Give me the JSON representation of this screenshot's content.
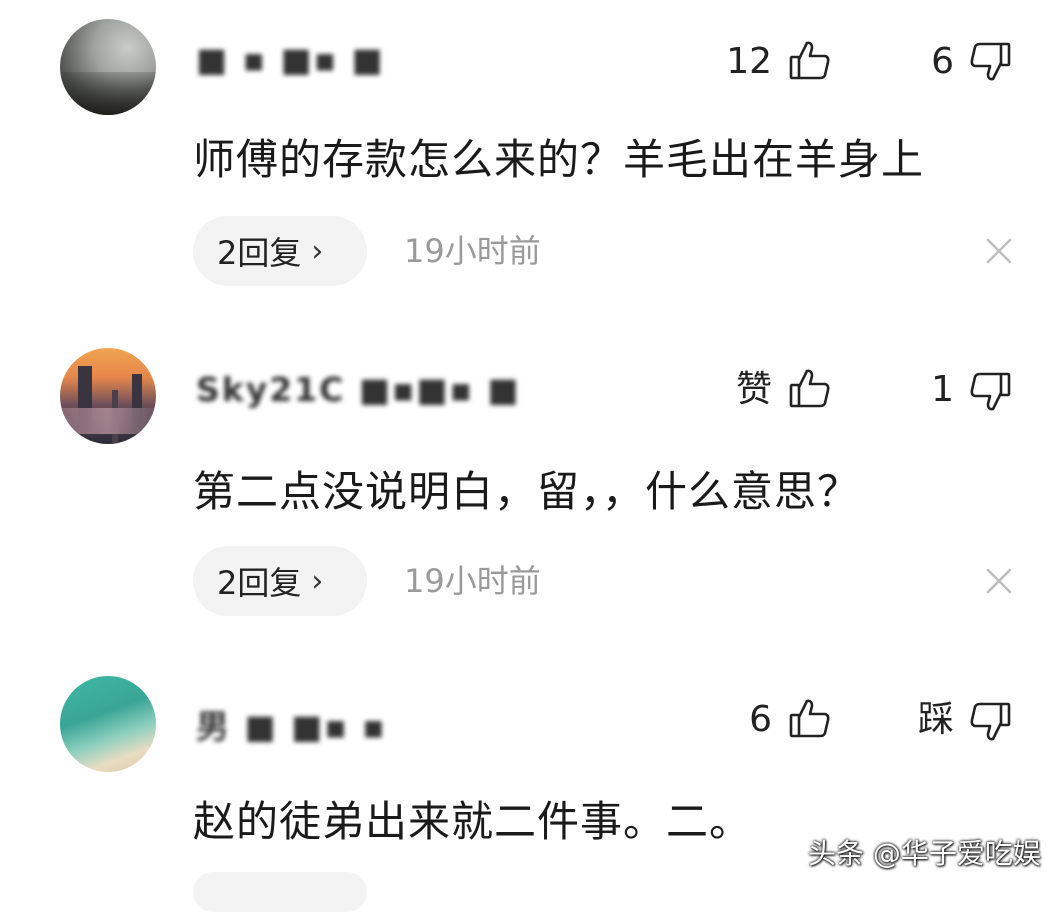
{
  "comments": [
    {
      "username": "■ ▪ ■▪ ■",
      "like_count": "12",
      "dislike_count": "6",
      "text": "师傅的存款怎么来的？羊毛出在羊身上",
      "reply_label": "2回复",
      "time": "19小时前"
    },
    {
      "username": "Sky21C ■▪■▪ ■",
      "like_count": "赞",
      "dislike_count": "1",
      "text": "第二点没说明白，留，，什么意思？",
      "reply_label": "2回复",
      "time": "19小时前"
    },
    {
      "username": "男 ■ ■▪ ▪",
      "like_count": "6",
      "dislike_count": "踩",
      "text": "赵的徒弟出来就二件事。二。",
      "reply_label": "",
      "time": ""
    }
  ],
  "icons": {
    "like": "thumbs-up-icon",
    "dislike": "thumbs-down-icon",
    "close": "close-icon",
    "chevron": "chevron-right-icon"
  },
  "chevron_glyph": "›",
  "watermark": "头条 @华子爱吃娱",
  "colors": {
    "text": "#1a1a1a",
    "muted": "#9a9a9a",
    "pill_bg": "#f3f3f3"
  }
}
